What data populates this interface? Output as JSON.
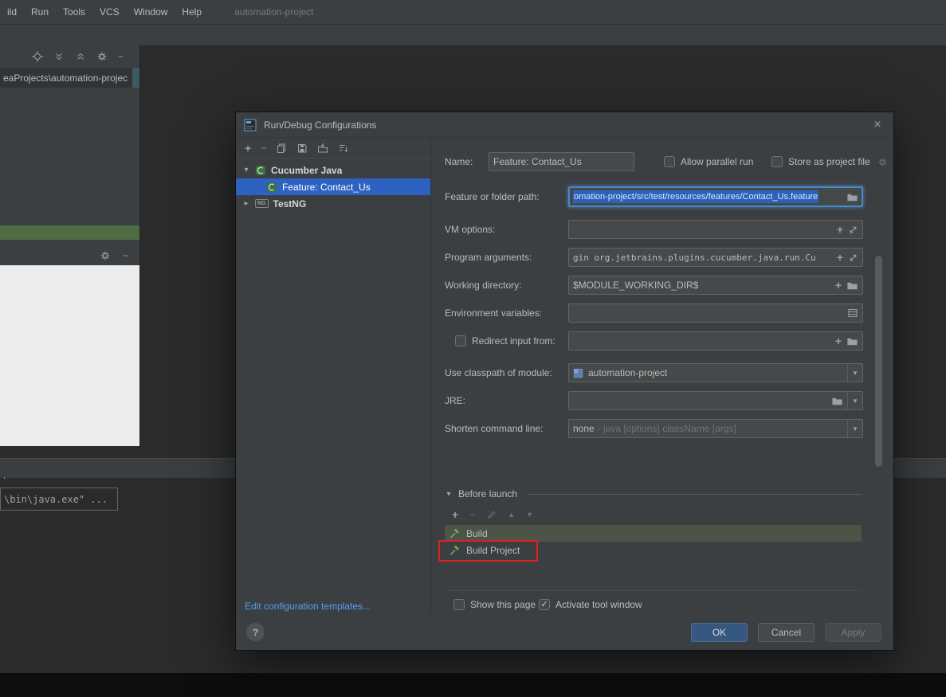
{
  "menubar": {
    "items": [
      "ild",
      "Run",
      "Tools",
      "VCS",
      "Window",
      "Help"
    ],
    "window_title": "automation-project"
  },
  "project_pane": {
    "tab_label": "eaProjects\\automation-projec"
  },
  "console": {
    "prompt_dot": ".",
    "line": "\\bin\\java.exe\" ..."
  },
  "dialog": {
    "title": "Run/Debug Configurations",
    "tree": {
      "cucumber_group": "Cucumber Java",
      "feature_item": "Feature: Contact_Us",
      "testng_group": "TestNG"
    },
    "edit_templates_link": "Edit configuration templates...",
    "name": {
      "label": "Name:",
      "value": "Feature: Contact_Us"
    },
    "allow_parallel_label": "Allow parallel run",
    "store_as_project_label": "Store as project file",
    "feature_path": {
      "label": "Feature or folder path:",
      "value": "omation-project/src/test/resources/features/Contact_Us.feature"
    },
    "vm_options": {
      "label": "VM options:",
      "value": ""
    },
    "program_arguments": {
      "label": "Program arguments:",
      "value": "gin org.jetbrains.plugins.cucumber.java.run.Cu"
    },
    "working_directory": {
      "label": "Working directory:",
      "value": "$MODULE_WORKING_DIR$"
    },
    "environment_variables": {
      "label": "Environment variables:",
      "value": ""
    },
    "redirect_input": {
      "label": "Redirect input from:",
      "value": ""
    },
    "use_classpath": {
      "label": "Use classpath of module:",
      "value": "automation-project"
    },
    "jre": {
      "label": "JRE:",
      "value": ""
    },
    "shorten_command_line": {
      "label": "Shorten command line:",
      "value": "none",
      "hint": "- java [options] className [args]"
    },
    "before_launch": {
      "label": "Before launch",
      "items": [
        "Build",
        "Build Project"
      ]
    },
    "show_this_page_label": "Show this page",
    "activate_tool_window_label": "Activate tool window",
    "buttons": {
      "help": "?",
      "ok": "OK",
      "cancel": "Cancel",
      "apply": "Apply"
    }
  },
  "colors": {
    "dialog_bg": "#3c3f41",
    "ide_bg": "#2b2b2b",
    "selection_blue": "#2d62c2",
    "text_selection_blue": "#2a62bc",
    "focus_border_blue": "#4a88c7",
    "ok_button_blue": "#365880",
    "link_blue": "#589df6",
    "annotation_red": "#e01f1f",
    "build_row_highlight": "#4d5447"
  },
  "icons": {
    "close": "×",
    "chevron_down": "▾",
    "chevron_right": "▸",
    "dropdown_arrow": "▼",
    "up_arrow": "▲",
    "down_arrow": "▼",
    "check": "✓",
    "plus": "+",
    "minus": "−",
    "testng": "NG"
  }
}
